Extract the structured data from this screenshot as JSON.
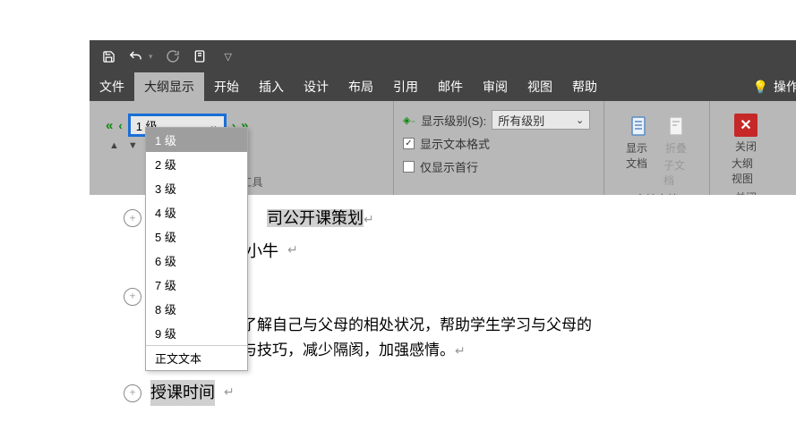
{
  "menus": {
    "file": "文件",
    "outline": "大纲显示",
    "home": "开始",
    "insert": "插入",
    "design": "设计",
    "layout": "布局",
    "references": "引用",
    "mail": "邮件",
    "review": "审阅",
    "view": "视图",
    "help": "帮助",
    "tell_me": "操作"
  },
  "ribbon": {
    "level_selected": "1 级",
    "show_level_label": "显示级别(S):",
    "show_level_value": "所有级别",
    "show_text_format": "显示文本格式",
    "show_first_line": "仅显示首行",
    "outline_tools_label": "大纲工具",
    "show_doc": "显示文档",
    "collapse_sub": "折叠",
    "collapse_sub2": "子文档",
    "master_doc_label": "主控文档",
    "close_view": "关闭",
    "close_view2": "大纲视图",
    "close_group_label": "关闭"
  },
  "dropdown_items": [
    "1 级",
    "2 级",
    "3 级",
    "4 级",
    "5 级",
    "6 级",
    "7 级",
    "8 级",
    "9 级",
    "正文文本"
  ],
  "doc": {
    "line1": "司公开课策划",
    "line2": "小牛",
    "body1": "了解自己与父母的相处状况，帮助学生学习与父母的",
    "body2": "与技巧，减少隔阂，加强感情。",
    "line3": "授课时间"
  }
}
